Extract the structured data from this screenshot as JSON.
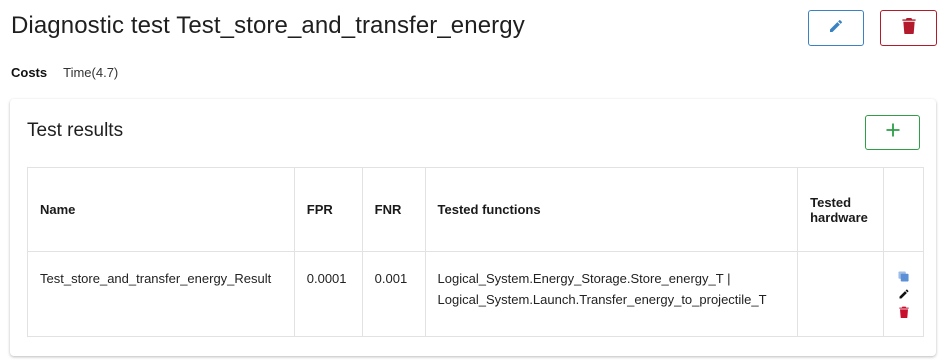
{
  "page": {
    "title": "Diagnostic test Test_store_and_transfer_energy"
  },
  "header_actions": {
    "edit_icon": "pencil-icon",
    "delete_icon": "trash-icon"
  },
  "costs": {
    "label": "Costs",
    "value": "Time(4.7)"
  },
  "results_card": {
    "title": "Test results",
    "add_icon": "plus-icon",
    "columns": {
      "name": "Name",
      "fpr": "FPR",
      "fnr": "FNR",
      "tested_functions": "Tested functions",
      "tested_hardware": "Tested hardware"
    },
    "rows": [
      {
        "name": "Test_store_and_transfer_energy_Result",
        "fpr": "0.0001",
        "fnr": "0.001",
        "tested_functions_1": "Logical_System.Energy_Storage.Store_energy_T |",
        "tested_functions_2": "Logical_System.Launch.Transfer_energy_to_projectile_T",
        "tested_hardware": ""
      }
    ]
  },
  "colors": {
    "edit_blue": "#3b82c4",
    "delete_red": "#b31b2c",
    "add_green": "#2e9e47",
    "copy_blue": "#5b8fd6"
  }
}
